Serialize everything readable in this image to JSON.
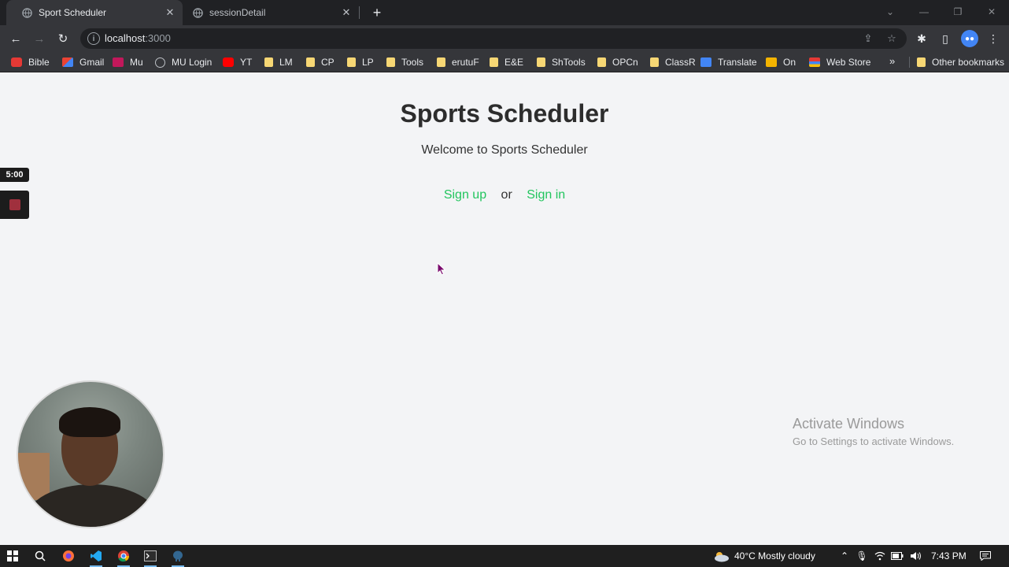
{
  "browser": {
    "tabs": [
      {
        "title": "Sport Scheduler",
        "active": true
      },
      {
        "title": "sessionDetail",
        "active": false
      }
    ],
    "address": {
      "host": "localhost",
      "port": ":3000"
    },
    "bookmarks": [
      {
        "label": "Bible",
        "icon": "red"
      },
      {
        "label": "Gmail",
        "icon": "gmail"
      },
      {
        "label": "Mu",
        "icon": "mu"
      },
      {
        "label": "MU Login",
        "icon": "globe"
      },
      {
        "label": "YT",
        "icon": "yt"
      },
      {
        "label": "LM",
        "icon": "folder"
      },
      {
        "label": "CP",
        "icon": "folder"
      },
      {
        "label": "LP",
        "icon": "folder"
      },
      {
        "label": "Tools",
        "icon": "folder"
      },
      {
        "label": "erutuF",
        "icon": "folder"
      },
      {
        "label": "E&E",
        "icon": "folder"
      },
      {
        "label": "ShTools",
        "icon": "folder"
      },
      {
        "label": "OPCn",
        "icon": "folder"
      },
      {
        "label": "ClassR",
        "icon": "folder"
      },
      {
        "label": "Translate",
        "icon": "tr"
      },
      {
        "label": "On",
        "icon": "on"
      },
      {
        "label": "Web Store",
        "icon": "ws"
      }
    ],
    "other_bookmarks": "Other bookmarks",
    "more_glyph": "»"
  },
  "page": {
    "title": "Sports Scheduler",
    "welcome": "Welcome to Sports Scheduler",
    "signup": "Sign up",
    "or": "or",
    "signin": "Sign in"
  },
  "overlay": {
    "timer": "5:00"
  },
  "watermark": {
    "line1": "Activate Windows",
    "line2": "Go to Settings to activate Windows."
  },
  "taskbar": {
    "weather": "40°C  Mostly cloudy",
    "time": "7:43 PM"
  },
  "colors": {
    "link": "#22c55e",
    "title": "#2d2d2d",
    "background": "#f3f4f6"
  }
}
